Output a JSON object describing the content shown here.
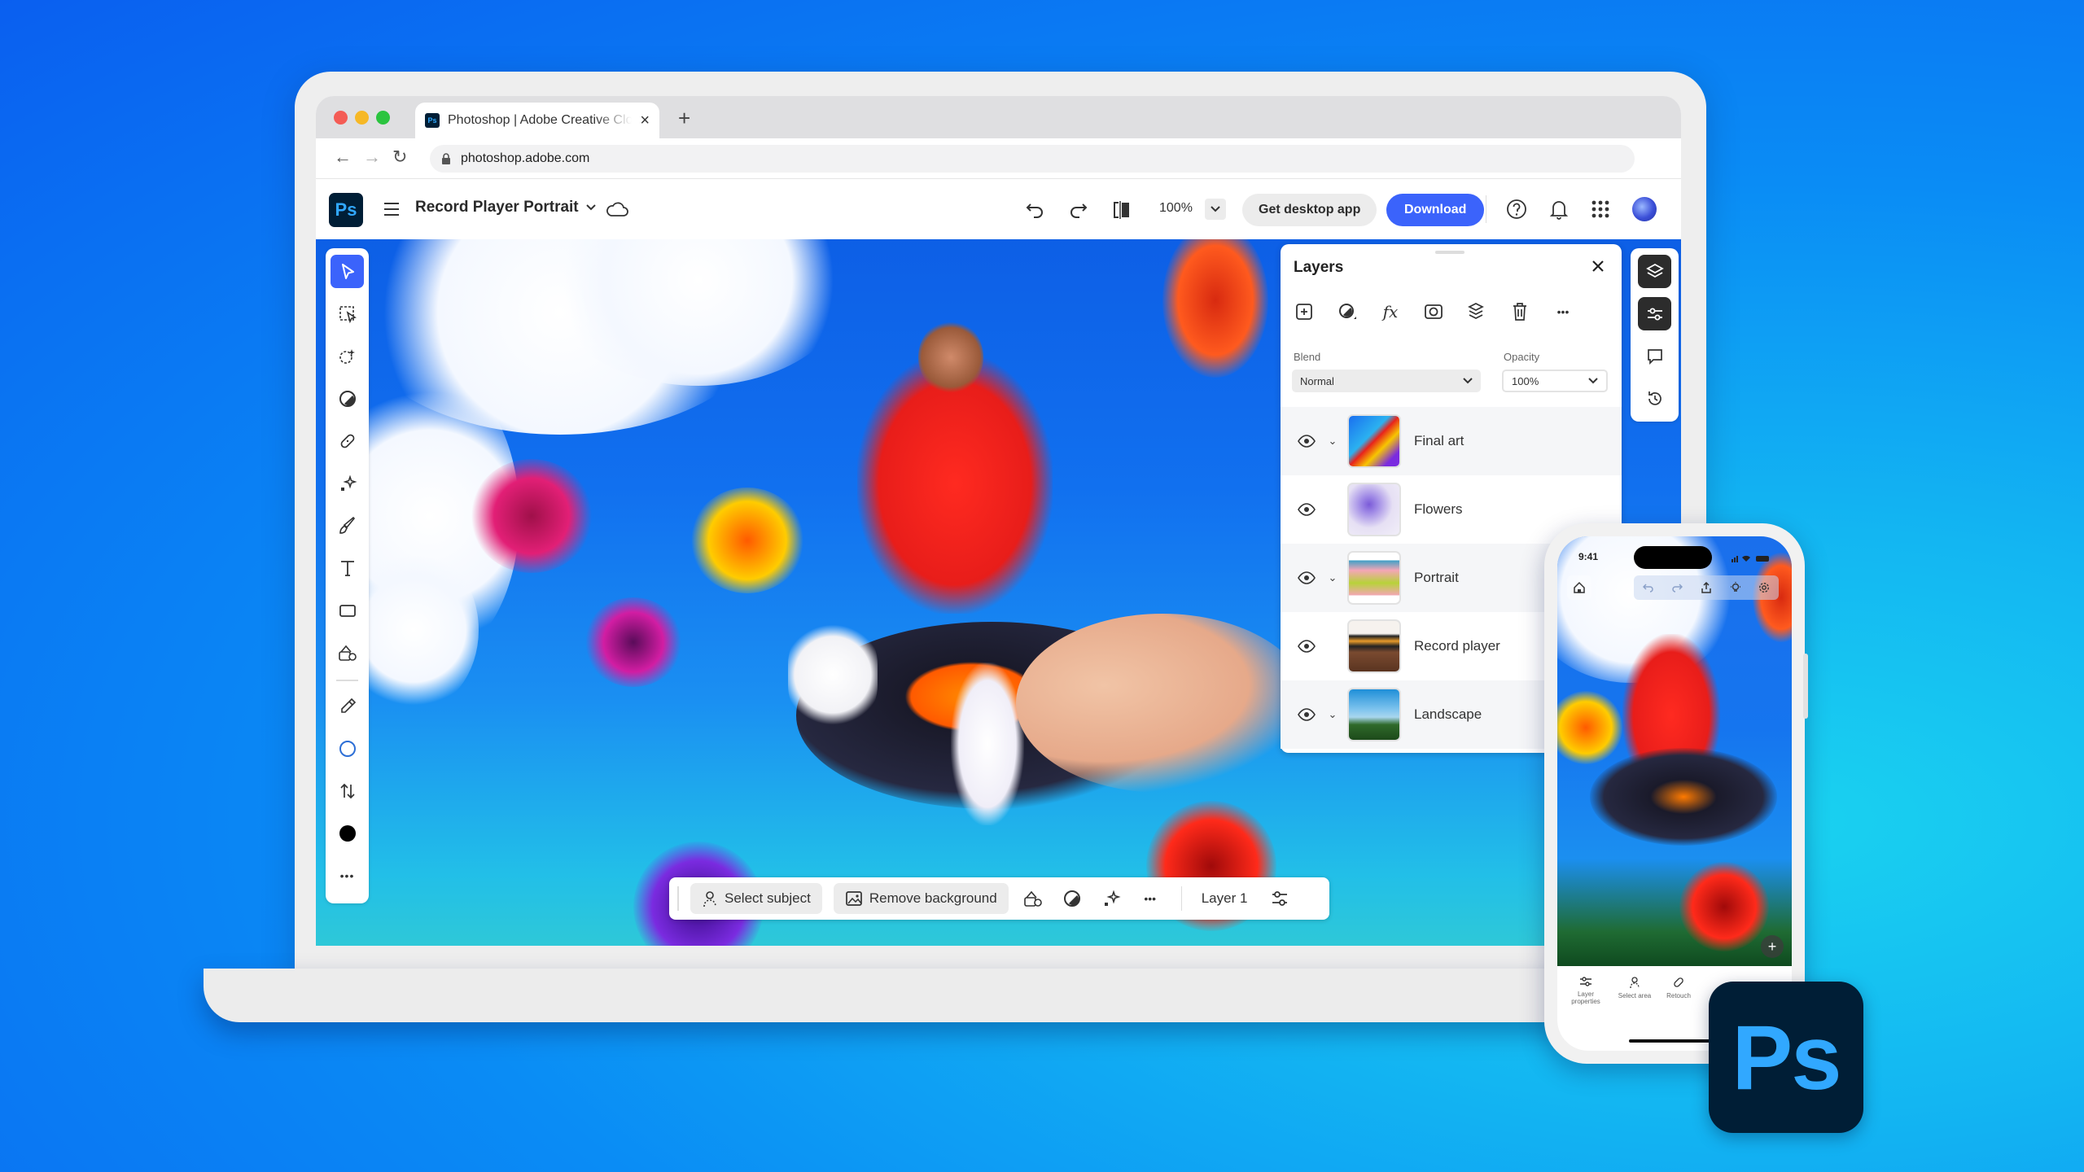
{
  "browser": {
    "tab_title": "Photoshop | Adobe Creative Cloud",
    "tab_favicon": "Ps",
    "new_tab": "+",
    "close_tab": "×",
    "url": "photoshop.adobe.com",
    "nav": {
      "back": "←",
      "forward": "→",
      "reload": "↻"
    }
  },
  "app_header": {
    "logo": "Ps",
    "document_title": "Record Player Portrait",
    "zoom_level": "100%",
    "get_desktop_label": "Get desktop app",
    "download_label": "Download",
    "colors": {
      "accent": "#3b63fb",
      "logo_bg": "#001e36",
      "logo_fg": "#31a8ff"
    }
  },
  "toolbar": {
    "tools": [
      {
        "name": "move-tool",
        "active": true
      },
      {
        "name": "object-selection-tool"
      },
      {
        "name": "quick-selection-tool"
      },
      {
        "name": "adjustment-tool"
      },
      {
        "name": "healing-brush-tool"
      },
      {
        "name": "generative-fill-tool"
      },
      {
        "name": "brush-tool"
      },
      {
        "name": "type-tool"
      },
      {
        "name": "shape-tool"
      },
      {
        "name": "image-tool"
      },
      {
        "name": "eyedropper-tool"
      },
      {
        "name": "foreground-color"
      },
      {
        "name": "swap-colors"
      },
      {
        "name": "background-color"
      },
      {
        "name": "more-tools"
      }
    ],
    "more_label": "•••"
  },
  "layers_panel": {
    "title": "Layers",
    "blend_label": "Blend",
    "blend_value": "Normal",
    "opacity_label": "Opacity",
    "opacity_value": "100%",
    "more_label": "•••",
    "layers": [
      {
        "name": "Final art",
        "expandable": true,
        "visible": true
      },
      {
        "name": "Flowers",
        "expandable": false,
        "visible": true
      },
      {
        "name": "Portrait",
        "expandable": true,
        "visible": true
      },
      {
        "name": "Record player",
        "expandable": false,
        "visible": true
      },
      {
        "name": "Landscape",
        "expandable": true,
        "visible": true
      }
    ]
  },
  "context_bar": {
    "select_subject": "Select subject",
    "remove_background": "Remove background",
    "more_label": "•••",
    "layer_name": "Layer 1"
  },
  "phone": {
    "time": "9:41",
    "bottom_actions": [
      "Layer properties",
      "Select area",
      "Retouch"
    ],
    "add_label": "+"
  },
  "brand_badge": "Ps"
}
